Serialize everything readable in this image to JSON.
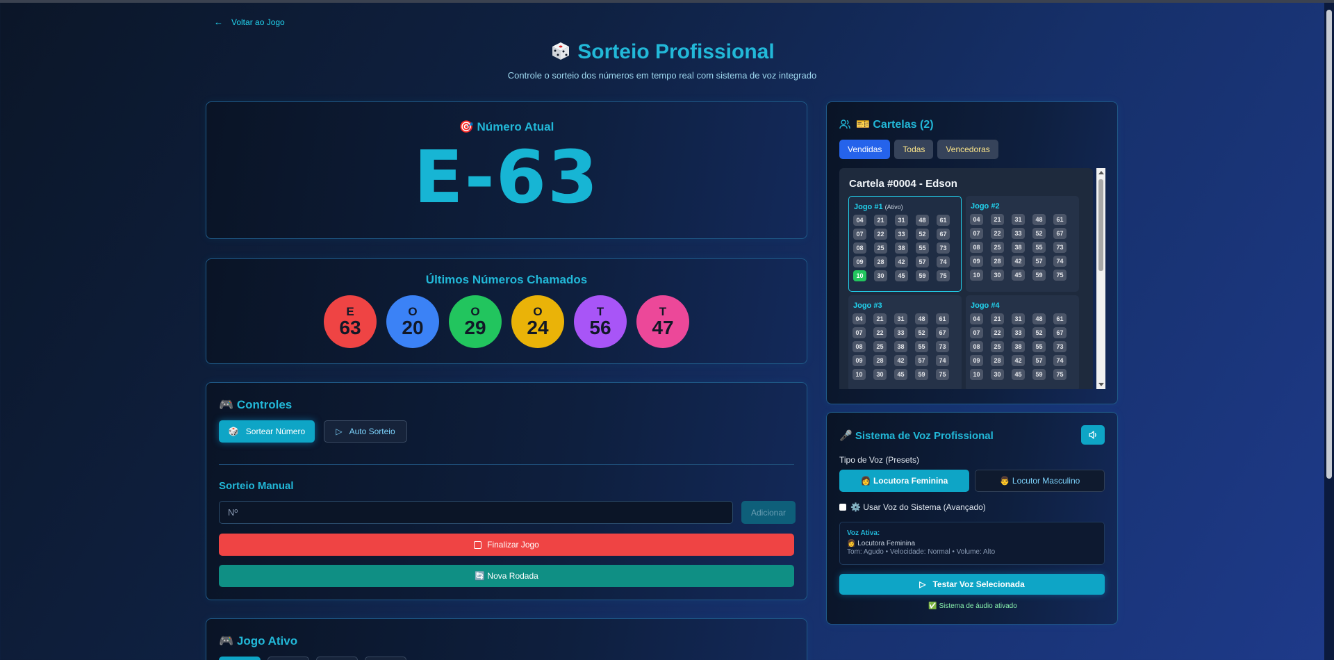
{
  "nav": {
    "back_label": "Voltar ao Jogo"
  },
  "header": {
    "title": "Sorteio Profissional",
    "subtitle": "Controle o sorteio dos números em tempo real com sistema de voz integrado"
  },
  "current": {
    "title": "🎯 Número Atual",
    "value": "E-63"
  },
  "last": {
    "title": "Últimos Números Chamados",
    "balls": [
      {
        "letter": "E",
        "number": "63",
        "color": "#ef4444"
      },
      {
        "letter": "O",
        "number": "20",
        "color": "#3b82f6"
      },
      {
        "letter": "O",
        "number": "29",
        "color": "#22c55e"
      },
      {
        "letter": "O",
        "number": "24",
        "color": "#eab308"
      },
      {
        "letter": "T",
        "number": "56",
        "color": "#a855f7"
      },
      {
        "letter": "T",
        "number": "47",
        "color": "#ec4899"
      }
    ]
  },
  "controls": {
    "title": "🎮 Controles",
    "draw_label": "Sortear Número",
    "auto_label": "Auto Sorteio",
    "manual_title": "Sorteio Manual",
    "manual_placeholder": "Nº",
    "add_label": "Adicionar",
    "finish_label": "Finalizar Jogo",
    "new_round_label": "🔄 Nova Rodada"
  },
  "active_game": {
    "title": "🎮 Jogo Ativo"
  },
  "cartelas": {
    "title": "🎫 Cartelas (2)",
    "filters": [
      "Vendidas",
      "Todas",
      "Vencedoras"
    ],
    "sheet_title": "Cartela #0004 - Edson",
    "games": [
      {
        "title": "Jogo #1",
        "tag": "(Ativo)"
      },
      {
        "title": "Jogo #2",
        "tag": ""
      },
      {
        "title": "Jogo #3",
        "tag": ""
      },
      {
        "title": "Jogo #4",
        "tag": ""
      }
    ],
    "grid": [
      [
        "04",
        "21",
        "31",
        "48",
        "61"
      ],
      [
        "07",
        "22",
        "33",
        "52",
        "67"
      ],
      [
        "08",
        "25",
        "38",
        "55",
        "73"
      ],
      [
        "09",
        "28",
        "42",
        "57",
        "74"
      ],
      [
        "10",
        "30",
        "45",
        "59",
        "75"
      ]
    ],
    "marked_in_active": [
      "10"
    ],
    "marked_color": "#22c55e"
  },
  "voice": {
    "title": "🎤 Sistema de Voz Profissional",
    "type_label": "Tipo de Voz (Presets)",
    "female_label": "👩 Locutora Feminina",
    "male_label": "👨 Locutor Masculino",
    "system_label": "⚙️ Usar Voz do Sistema (Avançado)",
    "active_title": "Voz Ativa:",
    "active_value": "👩 Locutora Feminina",
    "active_details": "Tom: Agudo • Velocidade: Normal • Volume: Alto",
    "test_label": "Testar Voz Selecionada",
    "status": "✅ Sistema de áudio ativado"
  },
  "colors": {
    "accent": "#0ea5c6",
    "title": "#22b8d8",
    "danger": "#ef4444",
    "success": "#0f8f84"
  }
}
